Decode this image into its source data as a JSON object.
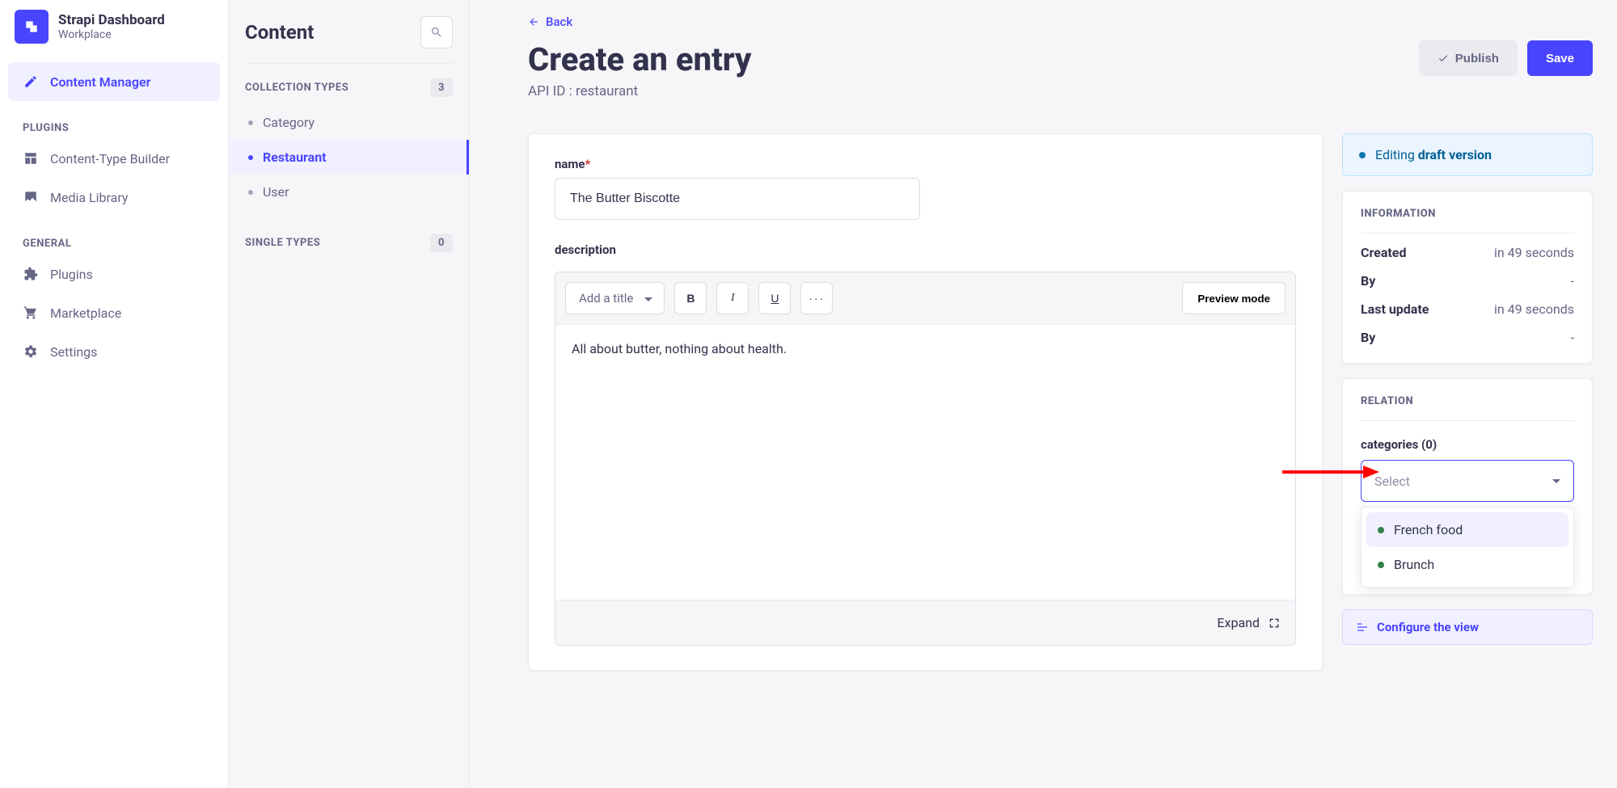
{
  "brand": {
    "title": "Strapi Dashboard",
    "subtitle": "Workplace"
  },
  "nav": {
    "content_manager": "Content Manager",
    "plugins_heading": "PLUGINS",
    "content_type_builder": "Content-Type Builder",
    "media_library": "Media Library",
    "general_heading": "GENERAL",
    "plugins": "Plugins",
    "marketplace": "Marketplace",
    "settings": "Settings"
  },
  "content_panel": {
    "title": "Content",
    "collection_heading": "COLLECTION TYPES",
    "collection_count": "3",
    "items": [
      "Category",
      "Restaurant",
      "User"
    ],
    "single_heading": "SINGLE TYPES",
    "single_count": "0"
  },
  "page": {
    "back": "Back",
    "title": "Create an entry",
    "api_id": "API ID : restaurant",
    "publish": "Publish",
    "save": "Save"
  },
  "fields": {
    "name_label": "name",
    "name_value": "The Butter Biscotte",
    "description_label": "description",
    "title_placeholder": "Add a title",
    "preview": "Preview mode",
    "body": "All about butter, nothing about health.",
    "expand": "Expand"
  },
  "status": {
    "editing_prefix": "Editing ",
    "editing_bold": "draft version"
  },
  "info": {
    "heading": "INFORMATION",
    "created_k": "Created",
    "created_v": "in 49 seconds",
    "by1_k": "By",
    "by1_v": "-",
    "update_k": "Last update",
    "update_v": "in 49 seconds",
    "by2_k": "By",
    "by2_v": "-"
  },
  "relation": {
    "heading": "RELATION",
    "label": "categories (0)",
    "placeholder": "Select",
    "options": [
      "French food",
      "Brunch"
    ]
  },
  "configure": "Configure the view"
}
